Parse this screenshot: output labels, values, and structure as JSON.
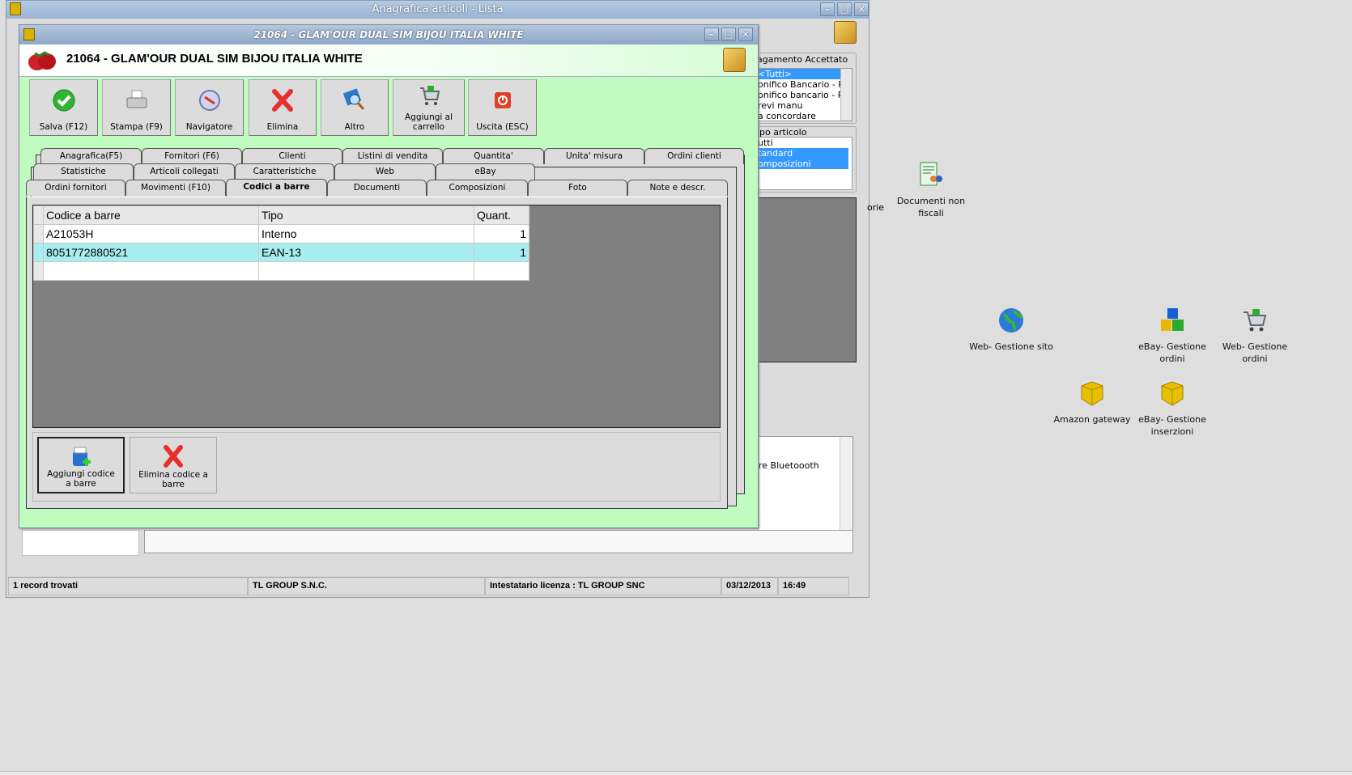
{
  "main_window": {
    "title": "Anagrafica articoli  - Lista",
    "controls": [
      "–",
      "□",
      "✕"
    ]
  },
  "dialog": {
    "title": "21064 - GLAM'OUR DUAL SIM BIJOU ITALIA WHITE",
    "header": "21064 - GLAM'OUR DUAL SIM BIJOU ITALIA WHITE",
    "controls": [
      "–",
      "□",
      "✕"
    ]
  },
  "toolbar": [
    {
      "label": "Salva (F12)",
      "icon": "check-icon"
    },
    {
      "label": "Stampa (F9)",
      "icon": "printer-icon"
    },
    {
      "label": "Navigatore",
      "icon": "compass-icon"
    },
    {
      "label": "Elimina",
      "icon": "delete-x-icon"
    },
    {
      "label": "Altro",
      "icon": "magnifier-icon"
    },
    {
      "label": "Aggiungi al carrello",
      "icon": "cart-icon"
    },
    {
      "label": "Uscita (ESC)",
      "icon": "exit-icon"
    }
  ],
  "tabs": {
    "row1": [
      "Anagrafica(F5)",
      "Fornitori (F6)",
      "Clienti",
      "Listini di vendita",
      "Quantita'",
      "Unita' misura",
      "Ordini clienti"
    ],
    "row2": [
      "Statistiche",
      "Articoli collegati",
      "Caratteristiche",
      "Web",
      "eBay"
    ],
    "row3": [
      "Ordini fornitori",
      "Movimenti (F10)",
      "Codici a barre",
      "Documenti",
      "Composizioni",
      "Foto",
      "Note e descr."
    ],
    "selected": "Codici a barre"
  },
  "barcodes": {
    "columns": [
      "Codice a barre",
      "Tipo",
      "Quant."
    ],
    "rows": [
      {
        "code": "A21053H",
        "type": "Interno",
        "qty": "1"
      },
      {
        "code": "8051772880521",
        "type": "EAN-13",
        "qty": "1"
      }
    ]
  },
  "bottom_buttons": [
    {
      "label": "Aggiungi codice a barre"
    },
    {
      "label": "Elimina codice a barre"
    }
  ],
  "filters": {
    "payment_label": "agamento Accettato",
    "payment_items": [
      "<Tutti>",
      "onifico Bancario - Pa",
      "onifico bancario - Pa",
      "revi manu",
      "a concordare"
    ],
    "type_label": "ipo articolo",
    "type_items": [
      "utti",
      "tandard",
      "omposizioni"
    ],
    "note_text": "re Bluetoooth"
  },
  "status": {
    "records": "1 record trovati",
    "company": "TL GROUP S.N.C.",
    "license": "Intestatario licenza : TL GROUP SNC",
    "date": "03/12/2013",
    "time": "16:49"
  },
  "desktop": {
    "partial": "orie",
    "icons": [
      {
        "label": "Documenti non fiscali"
      },
      {
        "label": "Web- Gestione sito"
      },
      {
        "label": "eBay- Gestione ordini"
      },
      {
        "label": "Web- Gestione ordini"
      },
      {
        "label": "Amazon gateway"
      },
      {
        "label": "eBay- Gestione inserzioni"
      }
    ]
  }
}
